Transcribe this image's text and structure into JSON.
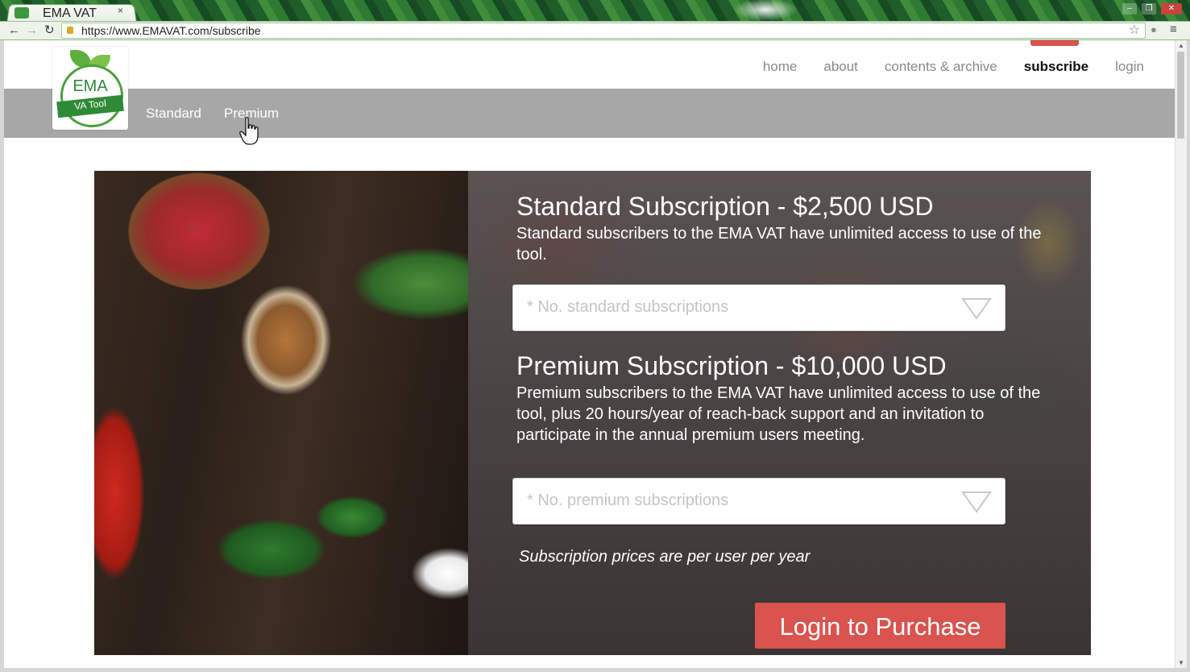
{
  "browser": {
    "tab_title": "EMA VAT",
    "tab_close": "×",
    "url": "https://www.EMAVAT.com/subscribe",
    "back_glyph": "←",
    "forward_glyph": "→",
    "reload_glyph": "↻",
    "star_glyph": "☆",
    "menu_glyph": "≡",
    "minimize_glyph": "–",
    "maximize_glyph": "❐",
    "close_glyph": "✕"
  },
  "logo": {
    "title": "EMA",
    "subtitle": "VA Tool"
  },
  "main_nav": {
    "items": [
      {
        "label": "home",
        "active": false
      },
      {
        "label": "about",
        "active": false
      },
      {
        "label": "contents & archive",
        "active": false
      },
      {
        "label": "subscribe",
        "active": true
      },
      {
        "label": "login",
        "active": false
      }
    ]
  },
  "sub_nav": {
    "items": [
      {
        "label": "Standard"
      },
      {
        "label": "Premium"
      }
    ]
  },
  "standard": {
    "title": "Standard Subscription - $2,500 USD",
    "description": "Standard subscribers to the EMA VAT have unlimited access to use of the tool.",
    "select_placeholder": "* No. standard subscriptions"
  },
  "premium": {
    "title": "Premium Subscription - $10,000 USD",
    "description": "Premium subscribers to the EMA VAT have unlimited access to use of the tool, plus 20 hours/year of reach-back support and an invitation to participate in the annual premium users meeting.",
    "select_placeholder": "* No. premium subscriptions"
  },
  "price_note": "Subscription prices are per user per year",
  "purchase_button": "Login to Purchase",
  "colors": {
    "accent": "#d9534f",
    "sub_bar": "#a7a7a7",
    "logo_green": "#2f8a38"
  },
  "icons": {
    "favicon": "leaf-favicon-icon",
    "dropdown": "triangle-down-icon",
    "cursor": "hand-pointer-icon",
    "lock": "padlock-icon"
  }
}
